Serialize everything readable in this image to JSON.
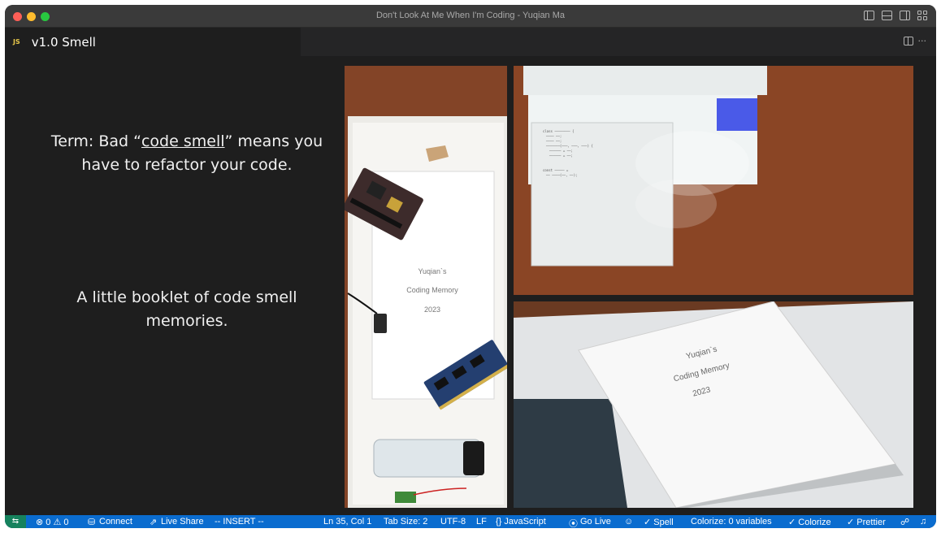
{
  "window": {
    "title": "Don't Look At Me When I'm Coding - Yuqian Ma"
  },
  "tab": {
    "icon_text": "JS",
    "label": "v1.0 Smell",
    "more": "···"
  },
  "slide": {
    "term_prefix": "Term: Bad “",
    "term_link": "code smell",
    "term_suffix": "” means you have to refactor your code.",
    "booklet": "A little booklet of code smell memories."
  },
  "photos": {
    "left": {
      "line1": "Yuqian`s",
      "line2": "Coding Memory",
      "line3": "2023"
    },
    "bottom": {
      "line1": "Yuqian`s",
      "line2": "Coding Memory",
      "line3": "2023"
    }
  },
  "statusbar": {
    "problems": "⊗ 0 ⚠ 0",
    "connect": "Connect",
    "live_share": "Live Share",
    "mode": "-- INSERT --",
    "position": "Ln 35, Col 1",
    "tab_size": "Tab Size: 2",
    "encoding": "UTF-8",
    "eol": "LF",
    "language": "{} JavaScript",
    "go_live": "Go Live",
    "spell": "✓ Spell",
    "colorize_vars": "Colorize: 0 variables",
    "colorize": "✓ Colorize",
    "prettier": "✓ Prettier"
  },
  "colors": {
    "status_bg": "#0a6ccf",
    "remote_bg": "#16825d",
    "editor_bg": "#1e1e1e",
    "js_badge": "#e8c84a"
  }
}
